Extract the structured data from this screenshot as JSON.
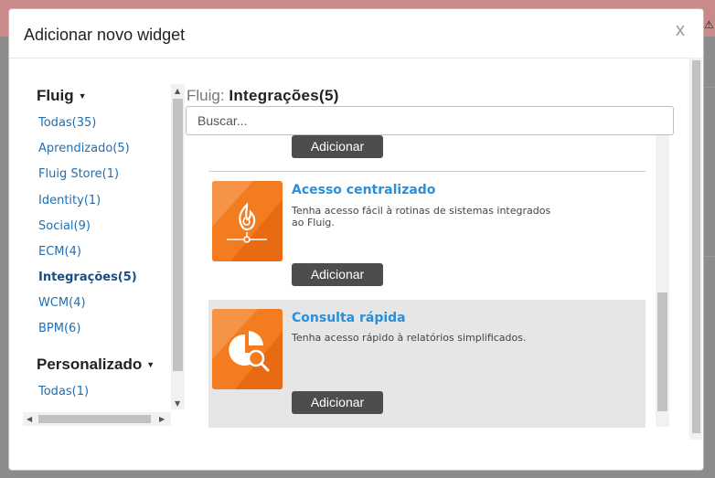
{
  "modal": {
    "title": "Adicionar novo widget",
    "close_label": "x"
  },
  "sidebar": {
    "groups": [
      {
        "title": "Fluig",
        "items": [
          {
            "label": "Todas(35)"
          },
          {
            "label": "Aprendizado(5)"
          },
          {
            "label": "Fluig Store(1)"
          },
          {
            "label": "Identity(1)"
          },
          {
            "label": "Social(9)"
          },
          {
            "label": "ECM(4)"
          },
          {
            "label": "Integrações(5)",
            "active": true
          },
          {
            "label": "WCM(4)"
          },
          {
            "label": "BPM(6)"
          }
        ]
      },
      {
        "title": "Personalizado",
        "items": [
          {
            "label": "Todas(1)"
          }
        ]
      }
    ]
  },
  "content": {
    "breadcrumb_prefix": "Fluig:",
    "breadcrumb_current": "Integrações(5)",
    "search_placeholder": "Buscar...",
    "widgets": [
      {
        "name": "Acesso centralizado",
        "description": "Tenha acesso fácil à rotinas de sistemas integrados ao Fluig.",
        "button": "Adicionar",
        "icon": "flame-network-icon"
      },
      {
        "name": "Consulta rápida",
        "description": "Tenha acesso rápido à relatórios simplificados.",
        "button": "Adicionar",
        "icon": "pie-chart-search-icon",
        "highlighted": true
      }
    ],
    "top_button": "Adicionar"
  },
  "colors": {
    "accent": "#f37b20",
    "link": "#1f6fb2",
    "button": "#4d4d4d"
  }
}
